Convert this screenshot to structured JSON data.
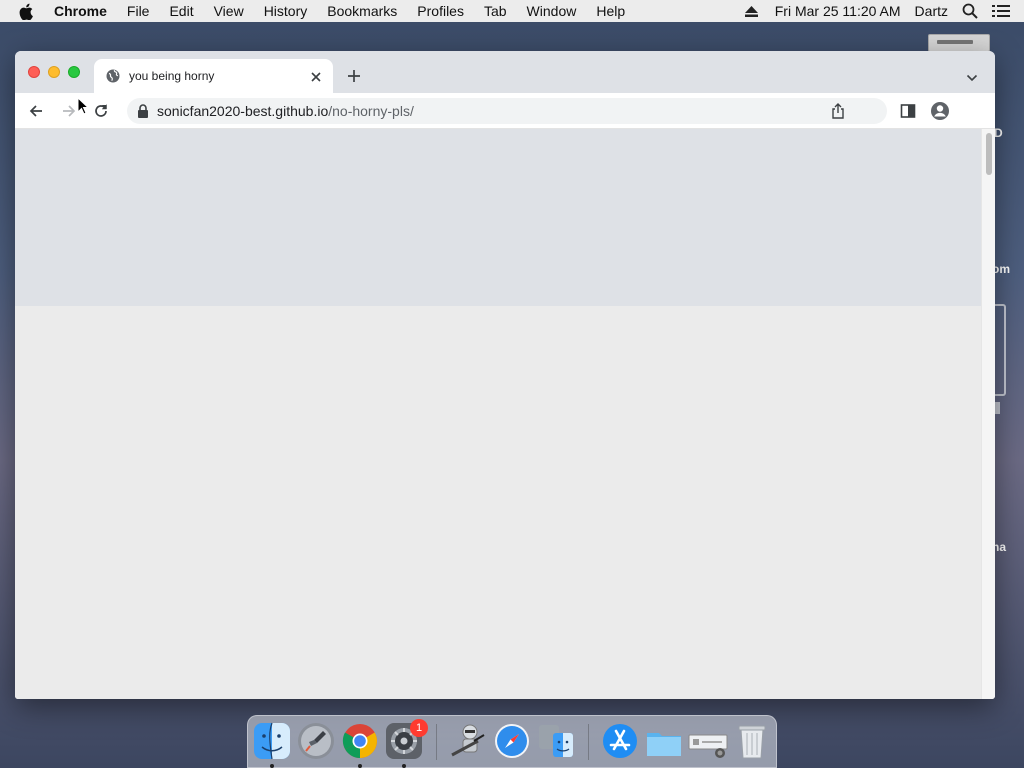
{
  "menubar": {
    "app_name": "Chrome",
    "items": [
      "File",
      "Edit",
      "View",
      "History",
      "Bookmarks",
      "Profiles",
      "Tab",
      "Window",
      "Help"
    ],
    "clock": "Fri Mar 25  11:20 AM",
    "user": "Dartz"
  },
  "desktop_peeks": {
    "label_1": "D",
    "label_2": "om",
    "label_3": "na"
  },
  "browser": {
    "tab": {
      "title": "you being horny",
      "icon": "globe-icon"
    },
    "address": {
      "host": "sonicfan2020-best.github.io",
      "path": "/no-horny-pls/"
    }
  },
  "dock": {
    "items": [
      "Finder",
      "Launchpad",
      "Google Chrome",
      "System Preferences",
      "Automator",
      "Safari",
      "Migration Assistant",
      "App Store",
      "Folder",
      "Screenshot",
      "Trash"
    ],
    "sys_prefs_badge": "1"
  },
  "colors": {
    "menubar": "#ececec",
    "tabstrip": "#dee1e6",
    "omnibox": "#f1f3f4",
    "page_top_band": "#dee1e6",
    "page_background": "#ebebeb"
  }
}
